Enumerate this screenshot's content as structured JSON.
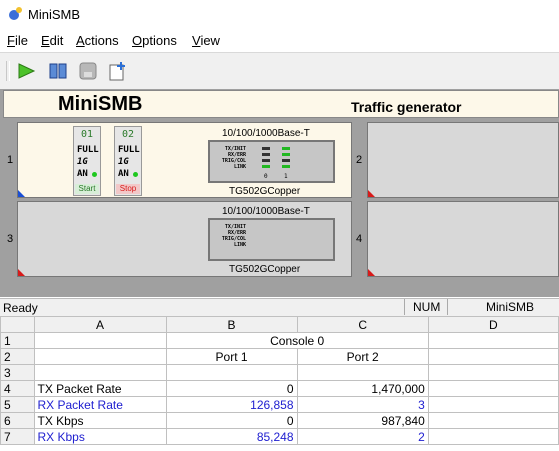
{
  "window": {
    "title": "MiniSMB"
  },
  "menu": {
    "items": [
      {
        "label": "File",
        "u": "F",
        "rest": "ile"
      },
      {
        "label": "Edit",
        "u": "E",
        "rest": "dit"
      },
      {
        "label": "Actions",
        "u": "A",
        "rest": "ctions"
      },
      {
        "label": "Options",
        "u": "O",
        "rest": "ptions"
      },
      {
        "label": "View",
        "u": "V",
        "rest": "iew"
      }
    ]
  },
  "toolbar": {
    "buttons": [
      "play-icon",
      "book-icon",
      "disk-icon",
      "new-document-icon"
    ]
  },
  "header": {
    "app_name": "MiniSMB",
    "subtitle": "Traffic generator"
  },
  "slots": {
    "s1": {
      "num": "1"
    },
    "s2": {
      "num": "2"
    },
    "s3": {
      "num": "3"
    },
    "s4": {
      "num": "4"
    }
  },
  "modules": {
    "m1": {
      "title": "10/100/1000Base-T",
      "name": "TG502GCopper",
      "labels": [
        "TX/INIT",
        "RX/ERR",
        "TRIG/COL",
        "LINK"
      ],
      "port_nums": [
        "0",
        "1"
      ]
    },
    "m3": {
      "title": "10/100/1000Base-T",
      "name": "TG502GCopper",
      "labels": [
        "TX/INIT",
        "RX/ERR",
        "TRIG/COL",
        "LINK"
      ]
    }
  },
  "ports": {
    "p1": {
      "num": "01",
      "duplex": "FULL",
      "speed": "1G",
      "neg": "AN",
      "button": "Start"
    },
    "p2": {
      "num": "02",
      "duplex": "FULL",
      "speed": "1G",
      "neg": "AN",
      "button": "Stop"
    }
  },
  "status": {
    "text": "Ready",
    "num": "NUM",
    "app": "MiniSMB"
  },
  "sheet": {
    "columns": [
      "A",
      "B",
      "C",
      "D"
    ],
    "rows": [
      {
        "n": "1",
        "a": "",
        "b": "Console 0",
        "c": "",
        "d": ""
      },
      {
        "n": "2",
        "a": "",
        "b": "Port 1",
        "c": "Port 2",
        "d": ""
      },
      {
        "n": "3",
        "a": "",
        "b": "",
        "c": "",
        "d": ""
      },
      {
        "n": "4",
        "a": "TX Packet Rate",
        "b": "0",
        "c": "1,470,000",
        "d": ""
      },
      {
        "n": "5",
        "a": "RX Packet Rate",
        "b": "126,858",
        "c": "3",
        "d": ""
      },
      {
        "n": "6",
        "a": "TX Kbps",
        "b": "0",
        "c": "987,840",
        "d": ""
      },
      {
        "n": "7",
        "a": "RX Kbps",
        "b": "85,248",
        "c": "2",
        "d": ""
      }
    ]
  },
  "colors": {
    "rx_text": "#2020d0",
    "panel_bg": "#fdf8e9",
    "led_on": "#22b822",
    "start_green": "#2a7a2a",
    "stop_red": "#d81a1a"
  }
}
